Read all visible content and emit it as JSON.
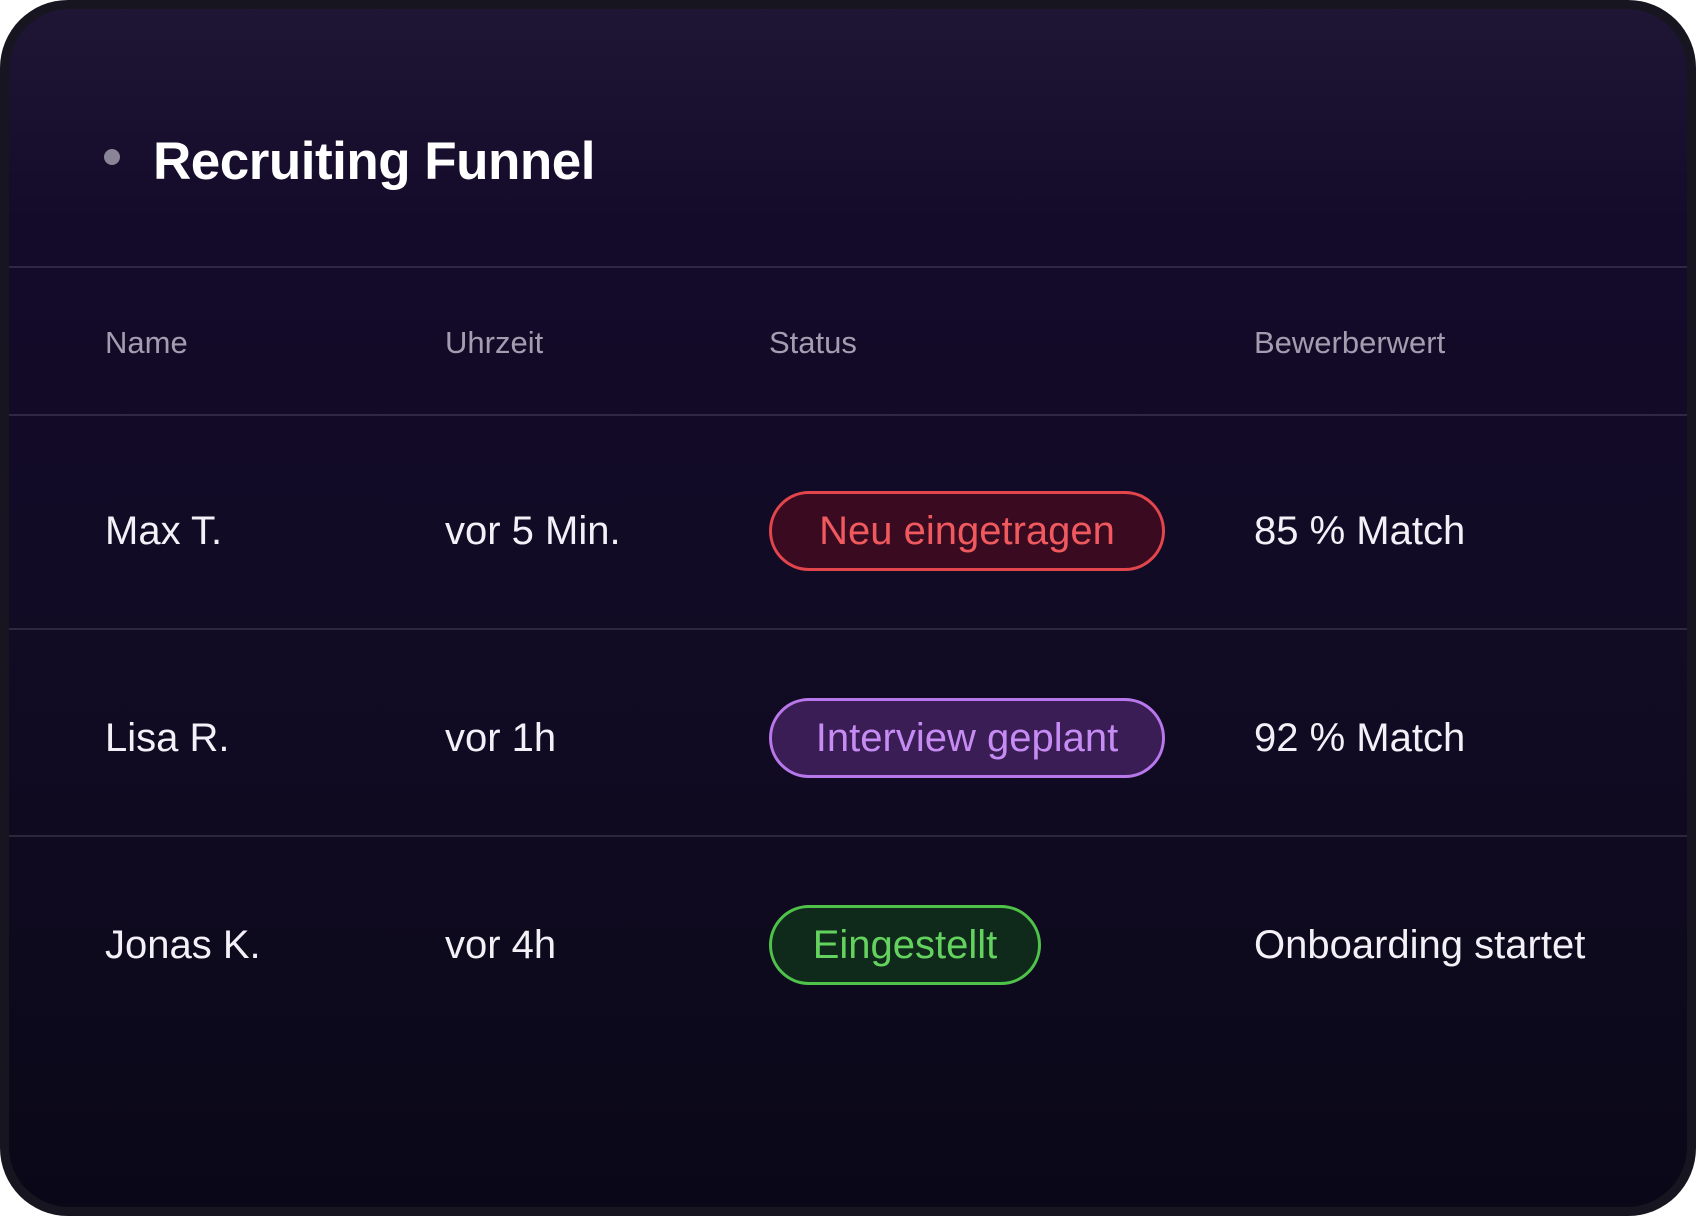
{
  "header": {
    "title": "Recruiting Funnel"
  },
  "table": {
    "columns": [
      "Name",
      "Uhrzeit",
      "Status",
      "Bewerberwert"
    ],
    "rows": [
      {
        "name": "Max T.",
        "time": "vor 5 Min.",
        "status": "Neu eingetragen",
        "value": "85 % Match"
      },
      {
        "name": "Lisa R.",
        "time": "vor 1h",
        "status": "Interview geplant",
        "value": "92 % Match"
      },
      {
        "name": "Jonas K.",
        "time": "vor 4h",
        "status": "Eingestellt",
        "value": "Onboarding startet"
      }
    ]
  },
  "colors": {
    "status_new": "#f05a5e",
    "status_interview": "#c07ff0",
    "status_hired": "#5ed05a"
  }
}
